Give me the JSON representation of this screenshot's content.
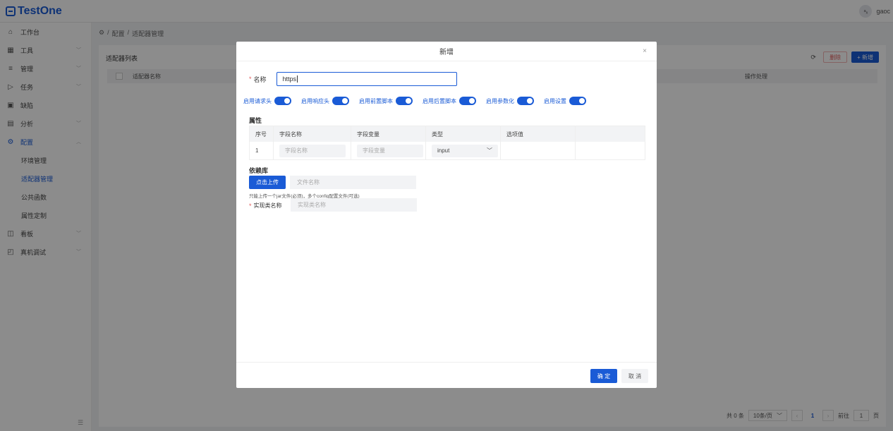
{
  "app": {
    "logo_text": "TestOne",
    "user_initial": "ᵃₓ",
    "user_name": "gaoc"
  },
  "sidebar": {
    "items": [
      {
        "label": "工作台",
        "icon": "home-icon",
        "glyph": "⌂"
      },
      {
        "label": "工具",
        "icon": "grid-icon",
        "glyph": "▦"
      },
      {
        "label": "管理",
        "icon": "list-icon",
        "glyph": "≡"
      },
      {
        "label": "任务",
        "icon": "send-icon",
        "glyph": "▷"
      },
      {
        "label": "缺陷",
        "icon": "bug-icon",
        "glyph": "▣"
      },
      {
        "label": "分析",
        "icon": "chart-icon",
        "glyph": "▤"
      },
      {
        "label": "配置",
        "icon": "gear-icon",
        "glyph": "⚙"
      },
      {
        "label": "看板",
        "icon": "board-icon",
        "glyph": "◫"
      },
      {
        "label": "真机调试",
        "icon": "device-icon",
        "glyph": "◰"
      }
    ],
    "sub_items": [
      "环境管理",
      "适配器管理",
      "公共函数",
      "属性定制"
    ],
    "collapse_glyph": "☰"
  },
  "breadcrumb": {
    "home_glyph": "⚙",
    "sep": "/",
    "level1": "配置",
    "level2": "适配器管理"
  },
  "panel": {
    "title": "适配器列表",
    "refresh_glyph": "⟳",
    "delete_label": "删除",
    "add_label": "+ 新增",
    "col_name": "适配器名称",
    "col_ops": "操作处理"
  },
  "pager": {
    "total": "共 0 条",
    "page_size": "10条/页",
    "page": "1",
    "goto": "前往",
    "goto_page": "1",
    "page_unit": "页"
  },
  "modal": {
    "title": "新增",
    "close_glyph": "×",
    "name_label": "名称",
    "name_value": "https",
    "toggles": [
      "启用请求头",
      "启用响应头",
      "启用前置脚本",
      "启用后置脚本",
      "启用参数化",
      "启用设置"
    ],
    "props_title": "属性",
    "props_headers": [
      "序号",
      "字段名称",
      "字段变量",
      "类型",
      "选项值",
      ""
    ],
    "props_row": {
      "index": "1",
      "field_name_ph": "字段名称",
      "field_var_ph": "字段变量",
      "type_value": "input"
    },
    "deps_title": "依赖库",
    "upload_label": "点击上传",
    "file_ph": "文件名称",
    "hint": "只能上传一个jar文件(必须)，多个config配置文件(可选)",
    "impl_label": "实现类名称",
    "impl_ph": "实现类名称",
    "ok_label": "确 定",
    "cancel_label": "取 消"
  },
  "colors": {
    "accent": "#1a5bd6",
    "danger": "#e25b5b"
  }
}
